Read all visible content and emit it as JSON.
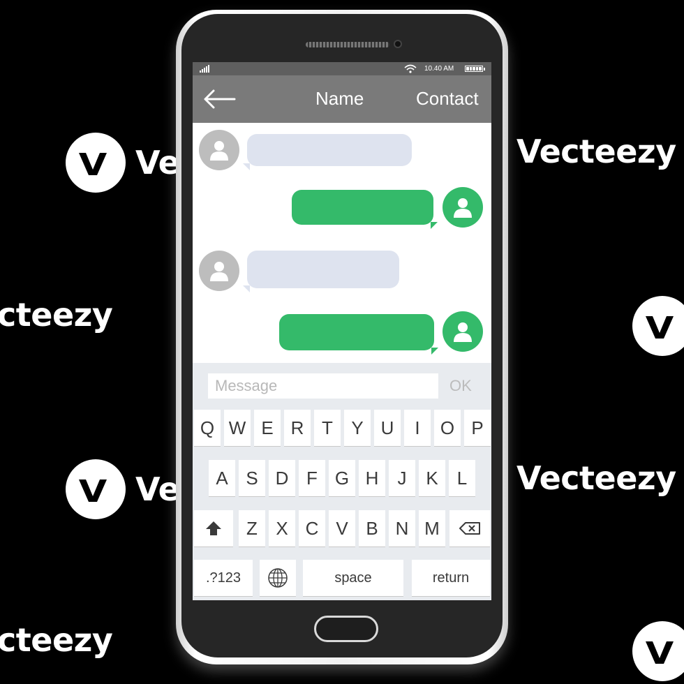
{
  "watermark": {
    "brand": "Vecteezy",
    "partial": "Vec",
    "cut": "cteezy"
  },
  "status_bar": {
    "time": "10.40 AM"
  },
  "header": {
    "back_icon": "arrow-left-icon",
    "title": "Name",
    "contact": "Contact"
  },
  "messages": [
    {
      "direction": "incoming"
    },
    {
      "direction": "outgoing"
    },
    {
      "direction": "incoming"
    },
    {
      "direction": "outgoing"
    }
  ],
  "composer": {
    "placeholder": "Message",
    "send_label": "OK"
  },
  "keyboard": {
    "row1": [
      "Q",
      "W",
      "E",
      "R",
      "T",
      "Y",
      "U",
      "I",
      "O",
      "P"
    ],
    "row2": [
      "A",
      "S",
      "D",
      "F",
      "G",
      "H",
      "J",
      "K",
      "L"
    ],
    "row3": [
      "Z",
      "X",
      "C",
      "V",
      "B",
      "N",
      "M"
    ],
    "shift_icon": "shift-arrow-icon",
    "backspace_icon": "backspace-icon",
    "globe_icon": "globe-icon",
    "symbols_label": ".?123",
    "space_label": "space",
    "return_label": "return"
  },
  "colors": {
    "incoming_bubble": "#dee3ef",
    "outgoing_bubble": "#34ba6a",
    "header": "#7a7a7a"
  }
}
